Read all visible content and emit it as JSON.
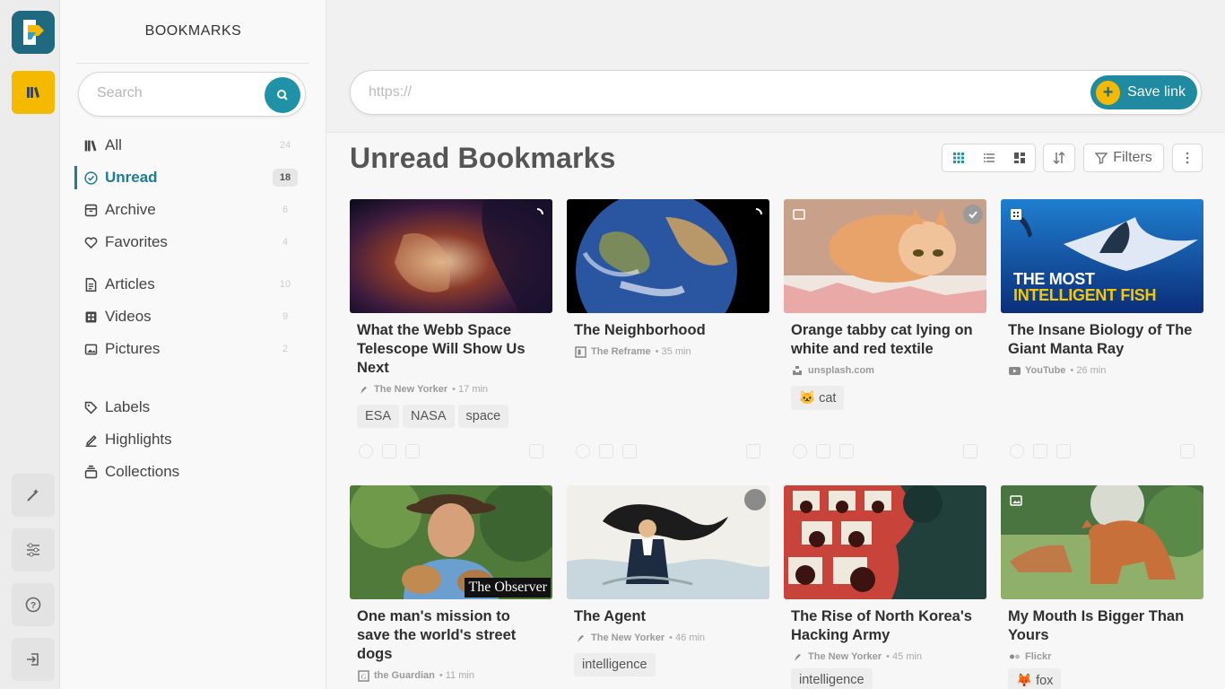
{
  "app": {
    "accent": "#1f8aa0",
    "brand_yellow": "#f5b900",
    "logo_icon": "app-logo-icon"
  },
  "rail": {
    "items": [
      {
        "name": "library-icon",
        "active": true
      },
      {
        "name": "magic-wand-icon",
        "active": false
      },
      {
        "name": "settings-sliders-icon",
        "active": false
      },
      {
        "name": "help-icon",
        "active": false
      },
      {
        "name": "logout-icon",
        "active": false
      }
    ]
  },
  "sidebar": {
    "title": "BOOKMARKS",
    "search": {
      "placeholder": "Search",
      "value": ""
    },
    "items": [
      {
        "label": "All",
        "count": "24",
        "icon": "library-icon"
      },
      {
        "label": "Unread",
        "count": "18",
        "icon": "check-circle-icon",
        "active": true
      },
      {
        "label": "Archive",
        "count": "6",
        "icon": "archive-icon"
      },
      {
        "label": "Favorites",
        "count": "4",
        "icon": "heart-icon"
      },
      {
        "label": "Articles",
        "count": "10",
        "icon": "article-icon"
      },
      {
        "label": "Videos",
        "count": "9",
        "icon": "video-icon"
      },
      {
        "label": "Pictures",
        "count": "2",
        "icon": "picture-icon"
      },
      {
        "label": "Labels",
        "icon": "tag-icon"
      },
      {
        "label": "Highlights",
        "icon": "pen-icon"
      },
      {
        "label": "Collections",
        "icon": "collections-icon"
      }
    ]
  },
  "header": {
    "url_placeholder": "https://",
    "url_value": "",
    "save_label": "Save link"
  },
  "main": {
    "title": "Unread Bookmarks",
    "filters_label": "Filters",
    "view_modes": [
      "grid-view-icon",
      "list-view-icon",
      "mosaic-view-icon"
    ],
    "cards": [
      {
        "title": "What the Webb Space Telescope Will Show Us Next",
        "source": "The New Yorker",
        "time": "• 17 min",
        "tags": [
          "ESA",
          "NASA",
          "space"
        ],
        "source_icon": "new-yorker-icon",
        "badge": "loading-icon"
      },
      {
        "title": "The Neighborhood",
        "source": "The Reframe",
        "time": "• 35 min",
        "tags": [],
        "source_icon": "reframe-icon",
        "badge": "loading-icon"
      },
      {
        "title": "Orange tabby cat lying on white and red textile",
        "source": "unsplash.com",
        "time": "",
        "tags": [
          "🐱 cat"
        ],
        "source_icon": "unsplash-icon",
        "badge": "check-circle-icon"
      },
      {
        "title": "The Insane Biology of The Giant Manta Ray",
        "source": "YouTube",
        "time": "• 26 min",
        "tags": [],
        "source_icon": "youtube-icon",
        "badge": "video-icon"
      },
      {
        "title": "One man's mission to save the world's street dogs",
        "source": "the Guardian",
        "time": "• 11 min",
        "tags": [],
        "source_icon": "guardian-icon"
      },
      {
        "title": "The Agent",
        "source": "The New Yorker",
        "time": "• 46 min",
        "tags": [
          "intelligence"
        ],
        "source_icon": "new-yorker-icon"
      },
      {
        "title": "The Rise of North Korea's Hacking Army",
        "source": "The New Yorker",
        "time": "• 45 min",
        "tags": [
          "intelligence"
        ],
        "source_icon": "new-yorker-icon"
      },
      {
        "title": "My Mouth Is Bigger Than Yours",
        "source": "Flickr",
        "time": "",
        "tags": [
          "🦊 fox"
        ],
        "source_icon": "flickr-icon",
        "badge": "picture-icon"
      }
    ],
    "image_texts": {
      "manta_line1": "THE MOST",
      "manta_line2": "INTELLIGENT FISH",
      "observer": "The Observer"
    }
  }
}
